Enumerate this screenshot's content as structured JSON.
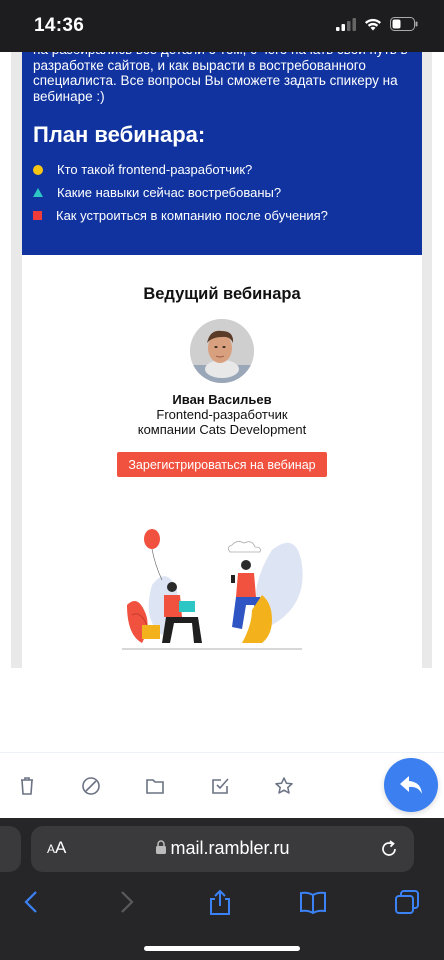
{
  "status_bar": {
    "time": "14:36"
  },
  "email": {
    "intro_text": "на разбирались все детали о том, с чего начать свой путь в разработке сайтов, и как вырасти в востребованного специалиста. Все вопросы Вы сможете задать спикеру на вебинаре :)",
    "plan_title": "План вебинара:",
    "plan_items": [
      {
        "text": "Кто такой frontend-разработчик?",
        "bullet": "circle",
        "color": "#f7c614"
      },
      {
        "text": "Какие навыки сейчас востребованы?",
        "bullet": "triangle",
        "color": "#2cc7c4"
      },
      {
        "text": "Как устроиться в компанию после обучения?",
        "bullet": "square",
        "color": "#ef3b3a"
      }
    ],
    "host_title": "Ведущий вебинара",
    "host_name": "Иван Васильев",
    "host_role_line1": "Frontend-разработчик",
    "host_role_line2": "компании Cats Development",
    "register_label": "Зарегистрироваться на вебинар",
    "colors": {
      "blue": "#10339f",
      "button": "#f0523f"
    }
  },
  "toolbar": {
    "icons": [
      "trash-icon",
      "block-icon",
      "folder-icon",
      "mark-read-icon",
      "star-icon"
    ],
    "reply_icon": "reply-icon",
    "reply_color": "#3b7ff0"
  },
  "safari": {
    "aa_label_big": "A",
    "aa_label_small": "A",
    "url": "mail.rambler.ru",
    "lock_icon": "lock-icon",
    "nav": [
      "back-icon",
      "forward-icon",
      "share-icon",
      "bookmarks-icon",
      "tabs-icon"
    ]
  }
}
